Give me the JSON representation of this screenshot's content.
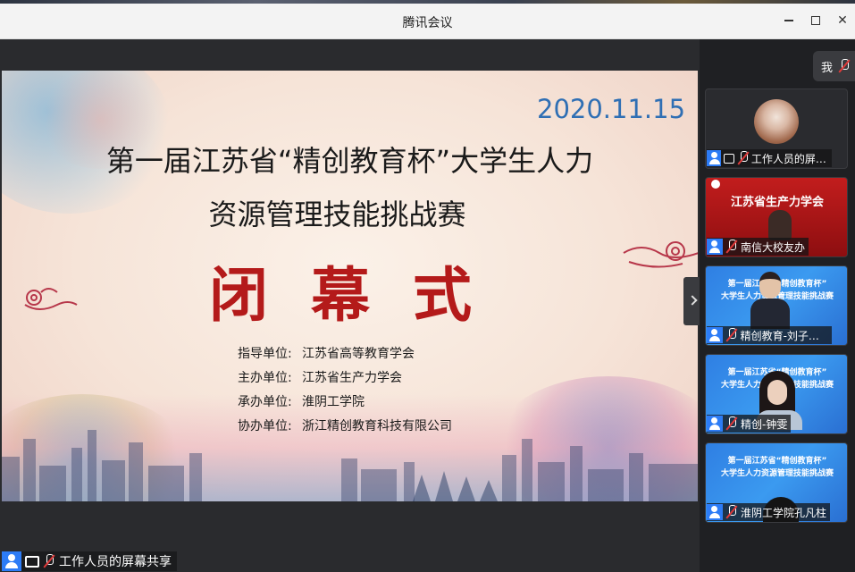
{
  "window": {
    "title": "腾讯会议"
  },
  "slide": {
    "date": "2020.11.15",
    "title_line1": "第一届江苏省“精创教育杯”大学生人力",
    "title_line2": "资源管理技能挑战赛",
    "closing": "闭幕式",
    "organizers": [
      {
        "label": "指导单位:",
        "value": "江苏省高等教育学会"
      },
      {
        "label": "主办单位:",
        "value": "江苏省生产力学会"
      },
      {
        "label": "承办单位:",
        "value": "淮阴工学院"
      },
      {
        "label": "协办单位:",
        "value": "浙江精创教育科技有限公司"
      }
    ]
  },
  "share_label": {
    "text": "工作人员的屏幕共享"
  },
  "me_button": {
    "label": "我"
  },
  "participants": [
    {
      "name": "工作人员的屏幕..."
    },
    {
      "name": "南信大校友办",
      "banner": "江苏省生产力学会"
    },
    {
      "name": "精创教育-刘子健...",
      "slide_line1": "第一届江苏省“精创教育杯”",
      "slide_line2": "大学生人力资源管理技能挑战赛"
    },
    {
      "name": "精创-钟雯",
      "slide_line1": "第一届江苏省“精创教育杯”",
      "slide_line2": "大学生人力资源管理技能挑战赛"
    },
    {
      "name": "淮阴工学院孔凡柱",
      "slide_line1": "第一届江苏省“精创教育杯”",
      "slide_line2": "大学生人力资源管理技能挑战赛"
    }
  ],
  "colors": {
    "accent_blue": "#2d7cf6",
    "date_blue": "#2f6fb4",
    "closing_red": "#b41a1a",
    "mute_red": "#e03a3a"
  }
}
